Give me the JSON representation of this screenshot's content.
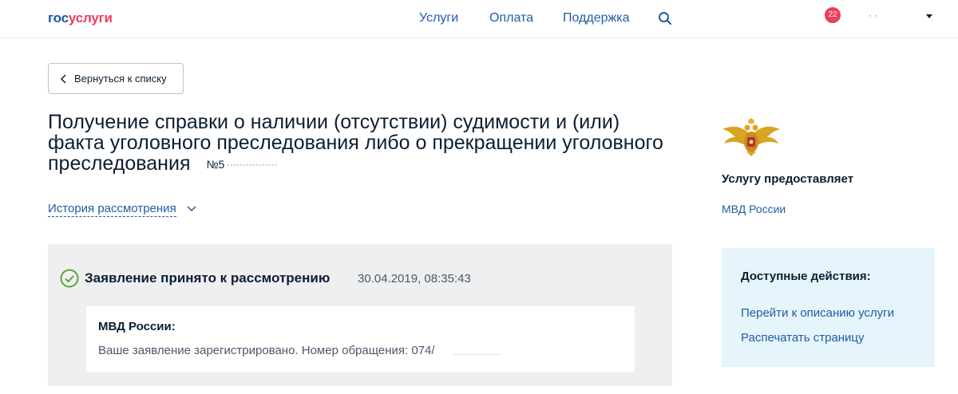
{
  "header": {
    "logo_part1": "гос",
    "logo_part2": "услуги",
    "nav": [
      "Услуги",
      "Оплата",
      "Поддержка"
    ],
    "search_icon": "search-icon",
    "notifications_count": "22",
    "user_name": "· ·",
    "colors": {
      "brand_blue": "#1a5aa0",
      "brand_red": "#ee3f58",
      "link": "#1f5da5"
    }
  },
  "back_button": {
    "label": "Вернуться к списку",
    "icon": "chevron-left-icon"
  },
  "service": {
    "title": "Получение справки о наличии (отсутствии) судимости и (или) факта уголовного преследования либо о прекращении уголовного преследования",
    "number_prefix": "№5"
  },
  "history": {
    "label": "История рассмотрения",
    "icon": "chevron-down-icon"
  },
  "status": {
    "text": "Заявление принято к рассмотрению",
    "datetime": "30.04.2019, 08:35:43",
    "icon": "check-circle-icon",
    "message": {
      "from": "МВД России:",
      "body": "Ваше заявление зарегистрировано. Номер обращения: 074/"
    }
  },
  "provider": {
    "emblem": "mvd-eagle-emblem",
    "label": "Услугу предоставляет",
    "name": "МВД России"
  },
  "actions": {
    "title": "Доступные действия:",
    "items": [
      "Перейти к описанию услуги",
      "Распечатать страницу"
    ]
  }
}
